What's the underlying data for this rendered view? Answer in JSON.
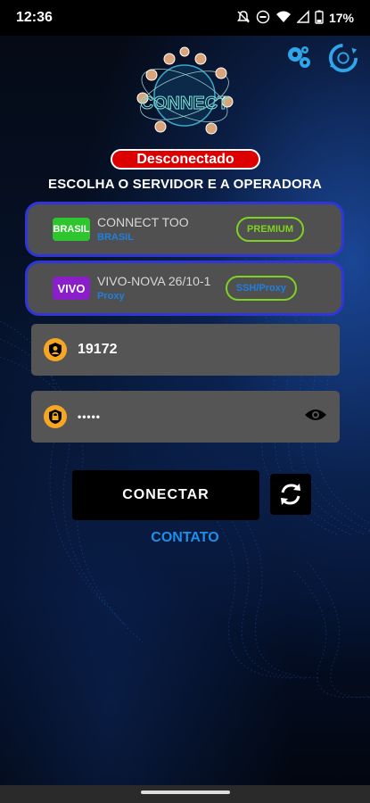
{
  "status_bar": {
    "time": "12:36",
    "battery": "17%",
    "icons": [
      "mute-icon",
      "dnd-icon",
      "wifi-icon",
      "signal-icon",
      "battery-icon"
    ]
  },
  "header": {
    "logo_text": "CONNECT",
    "settings_icon": "gear-icon",
    "refresh_icon": "refresh-icon"
  },
  "connection_status": "Desconectado",
  "section_title": "ESCOLHA O SERVIDOR E A OPERADORA",
  "server": {
    "flag_text": "BRASIL",
    "name": "CONNECT TOO",
    "subtitle": "BRASIL",
    "tag": "PREMIUM",
    "tag_color": "#7ed321"
  },
  "operator": {
    "flag_text": "VIVO",
    "name": "VIVO-NOVA 26/10-1",
    "subtitle": "Proxy",
    "tag": "SSH/Proxy",
    "tag_color": "#7ed321"
  },
  "username": {
    "value": "19172"
  },
  "password": {
    "value": "•••••"
  },
  "actions": {
    "connect_label": "CONECTAR",
    "contact_label": "CONTATO"
  },
  "colors": {
    "accent_blue": "#1f8fe8",
    "card_border": "#2f35d6",
    "status_red": "#dd0000",
    "field_icon": "#f5a623",
    "card_bg": "#505050"
  }
}
